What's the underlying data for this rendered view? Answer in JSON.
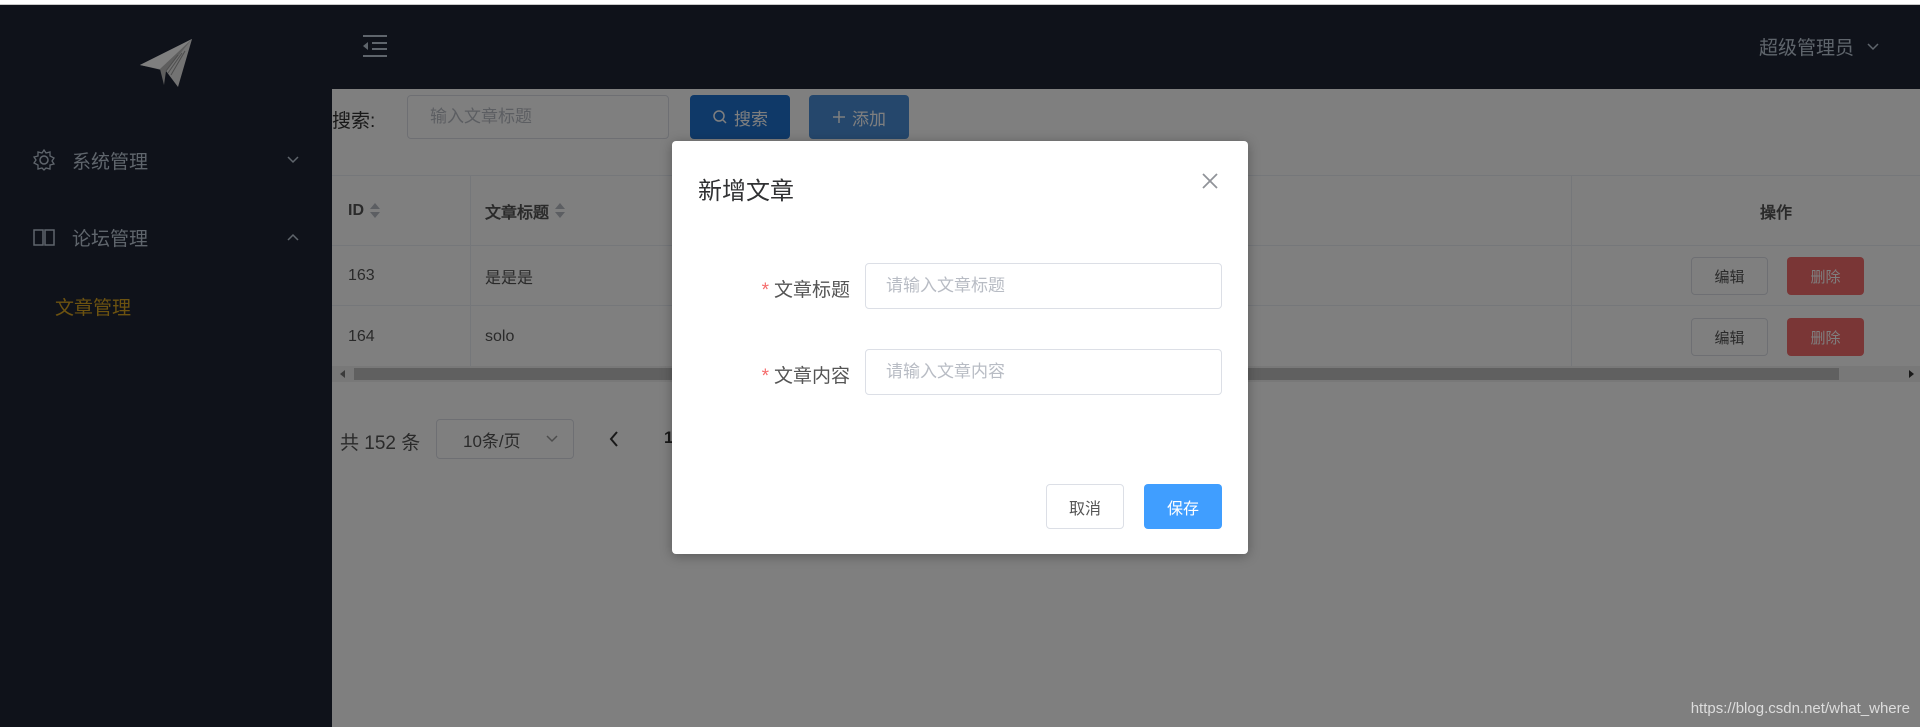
{
  "header": {
    "user_name": "超级管理员"
  },
  "sidebar": {
    "items": [
      {
        "label": "系统管理",
        "icon": "gear-icon",
        "expanded": false
      },
      {
        "label": "论坛管理",
        "icon": "book-icon",
        "expanded": true
      }
    ],
    "sub_items": [
      {
        "label": "文章管理",
        "active": true
      }
    ]
  },
  "toolbar": {
    "search_label": "搜索:",
    "search_placeholder": "输入文章标题",
    "search_button": "搜索",
    "add_button": "添加"
  },
  "table": {
    "columns": [
      "ID",
      "文章标题",
      "操作"
    ],
    "rows": [
      {
        "id": "163",
        "title": "是是是"
      },
      {
        "id": "164",
        "title": "solo"
      }
    ],
    "edit_label": "编辑",
    "delete_label": "删除"
  },
  "pagination": {
    "total": "共 152 条",
    "page_size": "10条/页",
    "current_page": "1"
  },
  "dialog": {
    "title": "新增文章",
    "fields": [
      {
        "label": "文章标题",
        "placeholder": "请输入文章标题",
        "required": true
      },
      {
        "label": "文章内容",
        "placeholder": "请输入文章内容",
        "required": true
      }
    ],
    "cancel_label": "取消",
    "save_label": "保存"
  },
  "watermark": "https://blog.csdn.net/what_where",
  "colors": {
    "sidebar_bg": "#1f2535",
    "active_menu": "#d9a520",
    "primary": "#409eff",
    "danger": "#f56c6c"
  }
}
